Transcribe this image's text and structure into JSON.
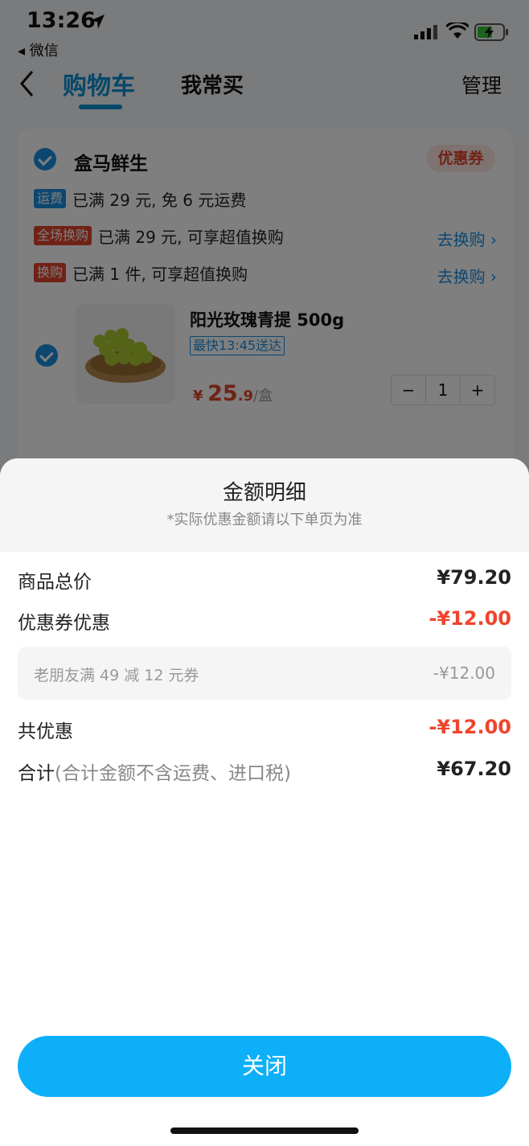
{
  "status": {
    "time": "13:26",
    "back_app": "◂ 微信"
  },
  "nav": {
    "tab_cart": "购物车",
    "tab_frequent": "我常买",
    "manage": "管理"
  },
  "store": {
    "name": "盒马鲜生",
    "coupon_label": "优惠券",
    "promos": [
      {
        "tag": "运费",
        "text": "已满 29 元, 免 6 元运费",
        "action": ""
      },
      {
        "tag": "全场换购",
        "text": "已满 29 元, 可享超值换购",
        "action": "去换购"
      },
      {
        "tag": "换购",
        "text": "已满 1 件, 可享超值换购",
        "action": "去换购"
      }
    ],
    "product": {
      "name": "阳光玫瑰青提  500g",
      "delivery": "最快13:45送达",
      "price_symbol": "¥",
      "price_int": "25",
      "price_dec": ".9",
      "price_unit": "/盒",
      "quantity": "1",
      "minus": "−",
      "plus": "+"
    }
  },
  "sheet": {
    "title": "金额明细",
    "subtitle": "*实际优惠金额请以下单页为准",
    "rows": {
      "subtotal": {
        "label": "商品总价",
        "value": "¥79.20"
      },
      "coupon": {
        "label": "优惠券优惠",
        "value": "-¥12.00"
      },
      "total_discount": {
        "label": "共优惠",
        "value": "-¥12.00"
      },
      "total": {
        "label": "合计",
        "note": "(合计金额不含运费、进口税)",
        "value": "¥67.20"
      }
    },
    "coupon_detail": {
      "name": "老朋友满 49 减 12 元券",
      "value": "-¥12.00"
    },
    "close_label": "关闭"
  },
  "colors": {
    "accent_blue": "#0b8fd6",
    "button_blue": "#0db0f8",
    "discount_red": "#f0442c"
  }
}
